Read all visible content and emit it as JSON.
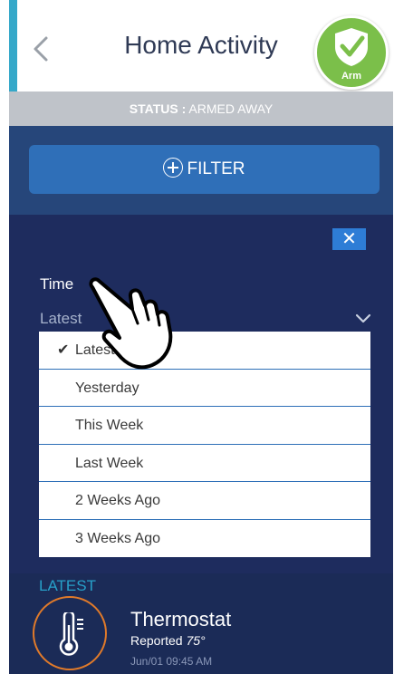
{
  "header": {
    "title": "Home Activity",
    "arm_label": "Arm",
    "colors": {
      "accent": "#35a8c9",
      "arm": "#7bbf4a"
    }
  },
  "status": {
    "label": "STATUS :",
    "value": "ARMED AWAY"
  },
  "filter": {
    "label": "FILTER",
    "close_symbol": "✕"
  },
  "time_filter": {
    "label": "Time",
    "selected": "Latest",
    "options": [
      {
        "label": "Latest",
        "checked": true
      },
      {
        "label": "Yesterday"
      },
      {
        "label": "This Week"
      },
      {
        "label": "Last Week"
      },
      {
        "label": "2 Weeks Ago"
      },
      {
        "label": "3 Weeks Ago"
      }
    ]
  },
  "activity": {
    "section_label": "LATEST",
    "items": [
      {
        "icon": "thermometer-icon",
        "name": "Thermostat",
        "status_prefix": "Reported",
        "status_value": "75°",
        "time": "Jun/01 09:45 AM"
      }
    ]
  }
}
